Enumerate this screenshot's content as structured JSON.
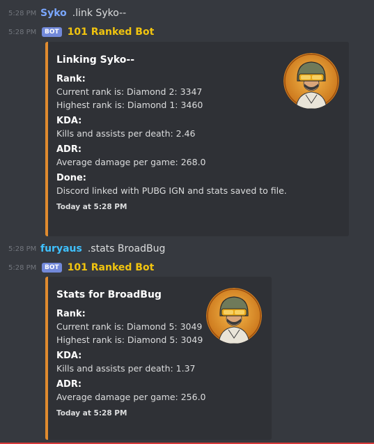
{
  "messages": [
    {
      "time": "5:28 PM",
      "user": "Syko",
      "user_color": "#7aa7ff",
      "text": ".link Syko--"
    },
    {
      "time": "5:28 PM",
      "badge": "BOT",
      "user": "101 Ranked Bot",
      "user_color": "#f1c40f"
    },
    {
      "time": "5:28 PM",
      "user": "furyaus",
      "user_color": "#3498db",
      "text": ".stats BroadBug"
    },
    {
      "time": "5:28 PM",
      "badge": "BOT",
      "user": "101 Ranked Bot",
      "user_color": "#f1c40f"
    }
  ],
  "embed1": {
    "title": "Linking Syko--",
    "fields": [
      {
        "name": "Rank:",
        "lines": [
          "Current rank is: Diamond 2: 3347",
          "Highest rank is: Diamond 1: 3460"
        ]
      },
      {
        "name": "KDA:",
        "lines": [
          "Kills and assists per death: 2.46"
        ]
      },
      {
        "name": "ADR:",
        "lines": [
          "Average damage per game: 268.0"
        ]
      },
      {
        "name": "Done:",
        "lines": [
          "Discord linked with PUBG IGN and stats saved to file."
        ]
      }
    ],
    "footer": "Today at 5:28 PM",
    "accent": "#e08b2f",
    "thumbnail_icon": "pubg-helmet-avatar-icon"
  },
  "embed2": {
    "title": "Stats for BroadBug",
    "fields": [
      {
        "name": "Rank:",
        "lines": [
          "Current rank is: Diamond 5: 3049",
          "Highest rank is: Diamond 5: 3049"
        ]
      },
      {
        "name": "KDA:",
        "lines": [
          "Kills and assists per death: 1.37"
        ]
      },
      {
        "name": "ADR:",
        "lines": [
          "Average damage per game: 256.0"
        ]
      }
    ],
    "footer": "Today at 5:28 PM",
    "accent": "#e08b2f",
    "thumbnail_icon": "pubg-helmet-avatar-icon"
  }
}
